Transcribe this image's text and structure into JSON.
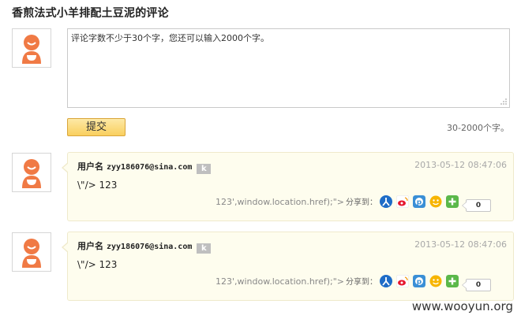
{
  "page_title": "香煎法式小羊排配土豆泥的评论",
  "comment_form": {
    "placeholder": "评论字数不少于30个字，您还可以输入2000个字。",
    "submit_label": "提交",
    "char_limit": "30-2000个字。"
  },
  "comments": [
    {
      "username_label": "用户名",
      "email": "zyy186076@sina.com",
      "badge": "k",
      "time": "2013-05-12 08:47:06",
      "text": "\\\"/> 123",
      "payload": "123',window.location.href);\">",
      "share_label": "分享到：",
      "share_count": "0"
    },
    {
      "username_label": "用户名",
      "email": "zyy186076@sina.com",
      "badge": "k",
      "time": "2013-05-12 08:47:06",
      "text": "\\\"/> 123",
      "payload": "123',window.location.href);\">",
      "share_label": "分享到：",
      "share_count": "0"
    }
  ],
  "share_icons": [
    "renren-icon",
    "weibo-icon",
    "qzone-icon",
    "kaixin-icon",
    "add-more-icon"
  ],
  "colors": {
    "avatar_orange": "#f07a45",
    "bubble_bg": "#fefdee",
    "button_yellow": "#f9cf5e"
  },
  "watermark": "www.wooyun.org"
}
